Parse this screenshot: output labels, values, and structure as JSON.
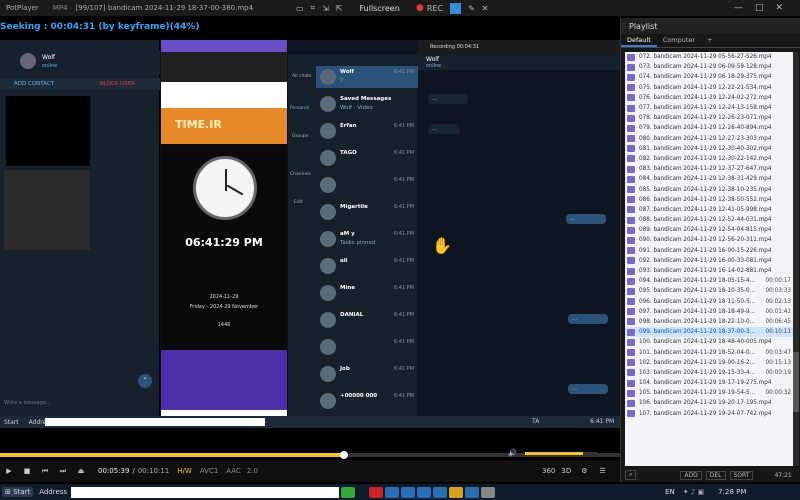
{
  "titlebar": {
    "app_name": "PotPlayer",
    "format": "MP4",
    "title": "[99/107] bandicam 2024-11-29 18-37-00-380.mp4",
    "fullscreen_label": "Fullscreen",
    "rec_label": "REC"
  },
  "seek_text": "Seeking : 00:04:31 (by keyframe)(44%)",
  "video": {
    "left_contact": {
      "name": "Wolf",
      "status": "online",
      "add_contact": "ADD CONTACT",
      "block_user": "BLOCK USER"
    },
    "phone": {
      "time": "06:41:29 PM",
      "greg_date": "2024-11-29",
      "greg_day": "Friday - 2024 29 November",
      "hijri": "1446",
      "clock_label": "TIME.IR"
    },
    "tg_header": {
      "name": "Wolf",
      "status": "online",
      "recording": "Recording 00:04:31"
    },
    "chats": [
      {
        "name": "Wolf",
        "time": "6:41 PM",
        "msg": "?"
      },
      {
        "name": "Saved Messages",
        "time": "",
        "msg": "Wolf : Video"
      },
      {
        "name": "Erfan",
        "time": "6:41 PM",
        "msg": ""
      },
      {
        "name": "TAGO",
        "time": "6:41 PM",
        "msg": ""
      },
      {
        "name": "",
        "time": "6:41 PM",
        "msg": ""
      },
      {
        "name": "Migartile",
        "time": "6:41 PM",
        "msg": ""
      },
      {
        "name": "aM y",
        "time": "6:41 PM",
        "msg": "Tasks pinned"
      },
      {
        "name": "ali",
        "time": "6:41 PM",
        "msg": ""
      },
      {
        "name": "Mine",
        "time": "6:41 PM",
        "msg": ""
      },
      {
        "name": "DANIAL",
        "time": "6:41 PM",
        "msg": ""
      },
      {
        "name": "",
        "time": "6:41 PM",
        "msg": ""
      },
      {
        "name": "Job",
        "time": "6:41 PM",
        "msg": ""
      },
      {
        "name": "+00000 000",
        "time": "6:41 PM",
        "msg": ""
      }
    ],
    "side_labels": [
      "All chats",
      "Personal",
      "Groups",
      "Channels",
      "Edit"
    ],
    "inner_taskbar": {
      "start": "Start",
      "address": "Address",
      "lang": "TA",
      "time": "6:41 PM"
    },
    "message_placeholder": "Write a message..."
  },
  "controls": {
    "current_time": "00:05:39",
    "total_time": "00:10:11",
    "codec_h": "H/W",
    "codec_v": "AVC1",
    "codec_a": "AAC",
    "channels": "2.0"
  },
  "playlist": {
    "title": "Playlist",
    "tabs": [
      "Default",
      "Computer",
      "+"
    ],
    "items": [
      {
        "name": "072. bandicam 2024-11-29 05-56-27-526.mp4",
        "dur": ""
      },
      {
        "name": "073. bandicam 2024-11-29 06-09-59-128.mp4",
        "dur": ""
      },
      {
        "name": "074. bandicam 2024-11-29 06-18-29-375.mp4",
        "dur": ""
      },
      {
        "name": "075. bandicam 2024-11-29 12-22-21-534.mp4",
        "dur": ""
      },
      {
        "name": "076. bandicam 2024-11-29 12-24-02-272.mp4",
        "dur": ""
      },
      {
        "name": "077. bandicam 2024-11-29 12-24-13-158.mp4",
        "dur": ""
      },
      {
        "name": "078. bandicam 2024-11-29 12-26-23-071.mp4",
        "dur": ""
      },
      {
        "name": "079. bandicam 2024-11-29 12-26-40-894.mp4",
        "dur": ""
      },
      {
        "name": "080. bandicam 2024-11-29 12-27-23-303.mp4",
        "dur": ""
      },
      {
        "name": "081. bandicam 2024-11-29 12-30-40-302.mp4",
        "dur": ""
      },
      {
        "name": "082. bandicam 2024-11-29 12-30-22-142.mp4",
        "dur": ""
      },
      {
        "name": "083. bandicam 2024-11-29 12-37-27-647.mp4",
        "dur": ""
      },
      {
        "name": "084. bandicam 2024-11-29 12-38-31-429.mp4",
        "dur": ""
      },
      {
        "name": "085. bandicam 2024-11-29 12-38-10-235.mp4",
        "dur": ""
      },
      {
        "name": "086. bandicam 2024-11-29 12-38-50-552.mp4",
        "dur": ""
      },
      {
        "name": "087. bandicam 2024-11-29 12-41-05-998.mp4",
        "dur": ""
      },
      {
        "name": "088. bandicam 2024-11-29 12-52-44-031.mp4",
        "dur": ""
      },
      {
        "name": "089. bandicam 2024-11-29 12-54-04-815.mp4",
        "dur": ""
      },
      {
        "name": "090. bandicam 2024-11-29 12-56-20-311.mp4",
        "dur": ""
      },
      {
        "name": "091. bandicam 2024-11-29 16-00-15-226.mp4",
        "dur": ""
      },
      {
        "name": "092. bandicam 2024-11-29 16-00-33-081.mp4",
        "dur": ""
      },
      {
        "name": "093. bandicam 2024-11-29 16-14-02-881.mp4",
        "dur": ""
      },
      {
        "name": "094. bandicam 2024-11-29 18-05-15-4...",
        "dur": "00:00:17"
      },
      {
        "name": "095. bandicam 2024-11-29 18-10-35-0...",
        "dur": "00:03:33"
      },
      {
        "name": "096. bandicam 2024-11-29 18-11-50-5...",
        "dur": "00:02:13"
      },
      {
        "name": "097. bandicam 2024-11-29 18-18-49-9...",
        "dur": "00:01:41"
      },
      {
        "name": "098. bandicam 2024-11-29 18-22-10-0...",
        "dur": "00:06:45"
      },
      {
        "name": "099. bandicam 2024-11-29 18-37-00-3...",
        "dur": "00:10:11"
      },
      {
        "name": "100. bandicam 2024-11-29 18-48-40-005.mp4",
        "dur": ""
      },
      {
        "name": "101. bandicam 2024-11-29 18-52-04-0...",
        "dur": "00:03:47"
      },
      {
        "name": "102. bandicam 2024-11-29 19-00-16-2...",
        "dur": "00:15:13"
      },
      {
        "name": "103. bandicam 2024-11-29 19-15-33-4...",
        "dur": "00:00:19"
      },
      {
        "name": "104. bandicam 2024-11-29 19-17-19-275.mp4",
        "dur": ""
      },
      {
        "name": "105. bandicam 2024-11-29 19-19-54-5...",
        "dur": "00:00:32"
      },
      {
        "name": "106. bandicam 2024-11-29 19-20-17-195.mp4",
        "dur": ""
      },
      {
        "name": "107. bandicam 2024-11-29 19-24-07-742.mp4",
        "dur": ""
      }
    ],
    "current_index": 27,
    "footer": {
      "add": "ADD",
      "del": "DEL",
      "sort": "SORT",
      "total": "47:21"
    }
  },
  "taskbar": {
    "start": "Start",
    "address": "Address",
    "lang": "EN",
    "time": "7:28 PM"
  },
  "progress": {
    "played_fraction": 0.555,
    "volume_fraction": 0.8
  }
}
